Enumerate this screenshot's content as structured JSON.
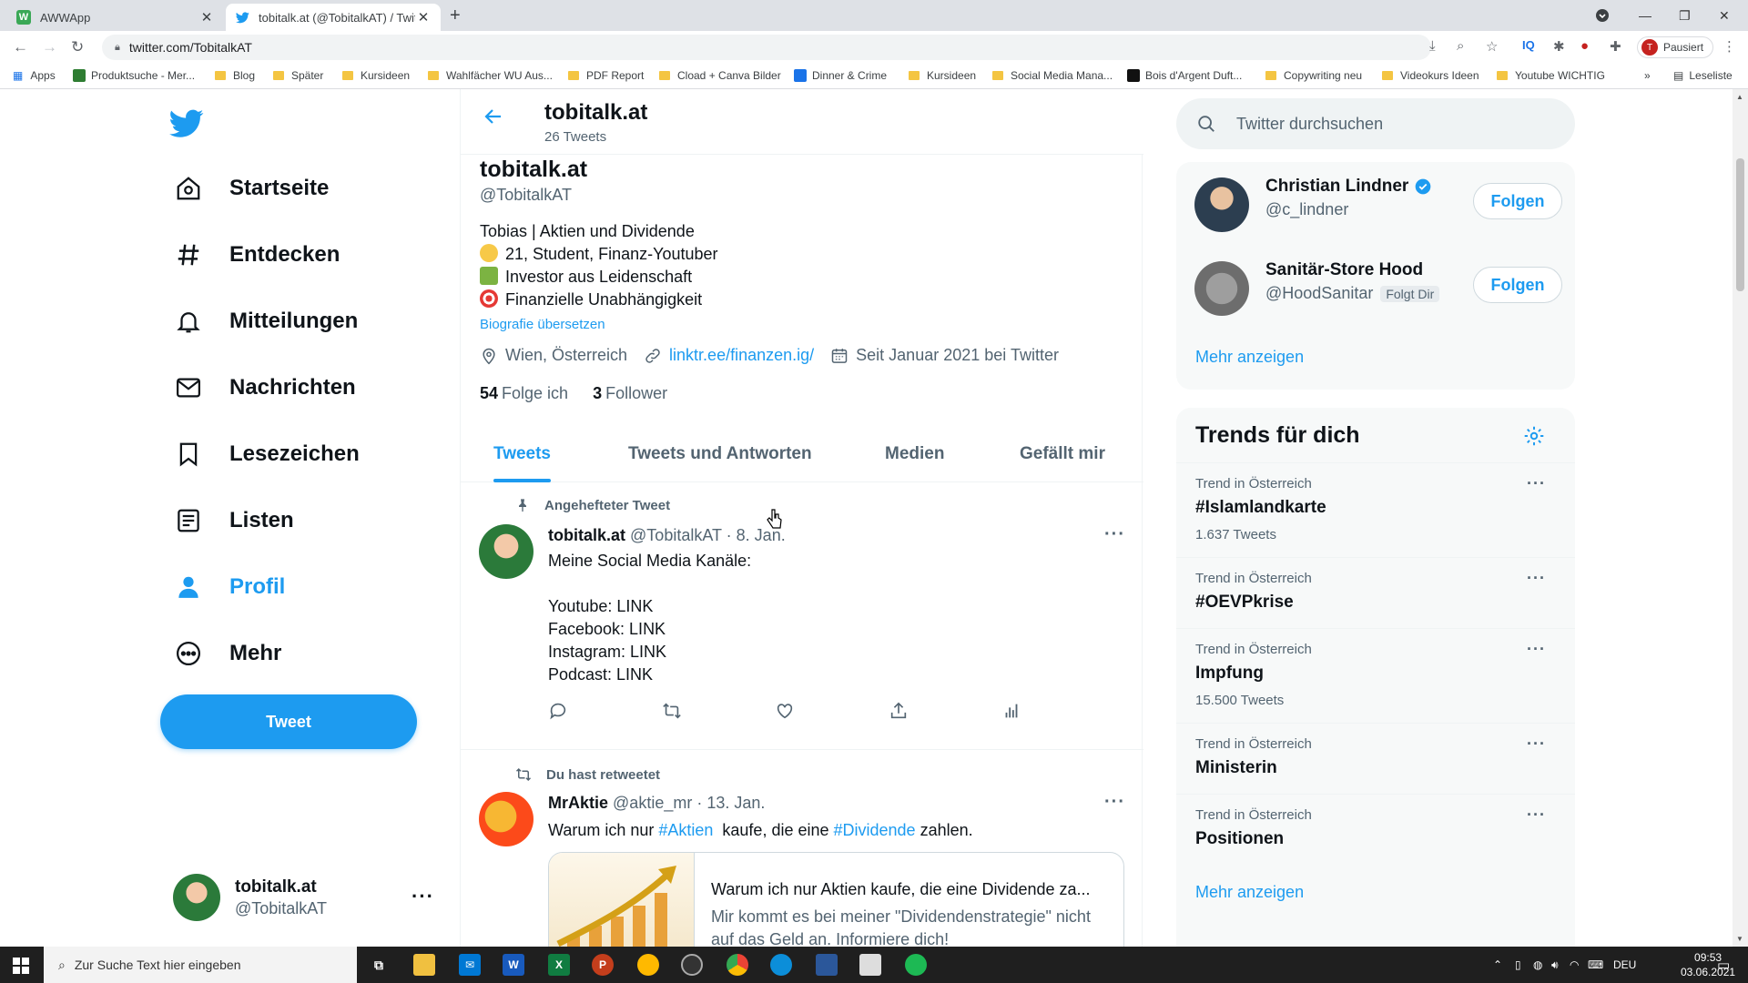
{
  "browser": {
    "tabs": [
      {
        "title": "AWWApp",
        "favicon": "awwapp-icon",
        "active": false
      },
      {
        "title": "tobitalk.at (@TobitalkAT) / Twitte",
        "favicon": "twitter-icon",
        "active": true
      }
    ],
    "address": "twitter.com/TobitalkAT",
    "profile_button": "Pausiert",
    "profile_initial": "T",
    "bookmarks": [
      "Apps",
      "Produktsuche - Mer...",
      "Blog",
      "Später",
      "Kursideen",
      "Wahlfächer WU Aus...",
      "PDF Report",
      "Cload + Canva Bilder",
      "Dinner & Crime",
      "Kursideen",
      "Social Media Mana...",
      "Bois d'Argent Duft...",
      "Copywriting neu",
      "Videokurs Ideen",
      "Youtube WICHTIG"
    ],
    "bookmarks_overflow": "»",
    "reading_list": "Leseliste"
  },
  "nav": {
    "items": [
      {
        "label": "Startseite",
        "icon": "home-icon"
      },
      {
        "label": "Entdecken",
        "icon": "hashtag-icon"
      },
      {
        "label": "Mitteilungen",
        "icon": "bell-icon"
      },
      {
        "label": "Nachrichten",
        "icon": "envelope-icon"
      },
      {
        "label": "Lesezeichen",
        "icon": "bookmark-icon"
      },
      {
        "label": "Listen",
        "icon": "list-icon"
      },
      {
        "label": "Profil",
        "icon": "person-icon"
      },
      {
        "label": "Mehr",
        "icon": "more-circle-icon"
      }
    ],
    "tweet_button": "Tweet",
    "account": {
      "name": "tobitalk.at",
      "handle": "@TobitalkAT",
      "more": "···"
    }
  },
  "header": {
    "title": "tobitalk.at",
    "subtitle": "26 Tweets"
  },
  "profile": {
    "name": "tobitalk.at",
    "handle": "@TobitalkAT",
    "bio": [
      "Tobias | Aktien und Dividende",
      "21, Student, Finanz-Youtuber",
      "Investor aus Leidenschaft",
      "Finanzielle Unabhängigkeit"
    ],
    "translate": "Biografie übersetzen",
    "location": "Wien, Österreich",
    "link": "linktr.ee/finanzen.ig/",
    "joined": "Seit Januar 2021 bei Twitter",
    "following_count": "54",
    "following_label": "Folge ich",
    "followers_count": "3",
    "followers_label": "Follower"
  },
  "profile_tabs": [
    "Tweets",
    "Tweets und Antworten",
    "Medien",
    "Gefällt mir"
  ],
  "tweets": [
    {
      "context": "Angehefteter Tweet",
      "name": "tobitalk.at",
      "meta": "@TobitalkAT · 8. Jan.",
      "body": "Meine Social Media Kanäle:\n\nYoutube: LINK\nFacebook: LINK\nInstagram: LINK\nPodcast: LINK",
      "more": "···"
    },
    {
      "context": "Du hast retweetet",
      "name": "MrAktie",
      "meta": "@aktie_mr · 13. Jan.",
      "body_pre": "Warum ich nur ",
      "tag1": "#Aktien",
      "body_mid": "  kaufe, die eine ",
      "tag2": "#Dividende",
      "body_post": " zahlen.",
      "card_title": "Warum ich nur Aktien kaufe, die eine Dividende za...",
      "card_desc": "Mir kommt es bei meiner \"Dividendenstrategie\" nicht auf das Geld an. Informiere dich!",
      "more": "···"
    }
  ],
  "search": {
    "placeholder": "Twitter durchsuchen"
  },
  "who_to_follow": [
    {
      "name": "Christian Lindner",
      "handle": "@c_lindner",
      "verified": true,
      "follows_you": "",
      "button": "Folgen"
    },
    {
      "name": "Sanitär-Store Hood",
      "handle": "@HoodSanitar",
      "verified": false,
      "follows_you": "Folgt Dir",
      "button": "Folgen"
    }
  ],
  "who_more": "Mehr anzeigen",
  "trends": {
    "title": "Trends für dich",
    "items": [
      {
        "context": "Trend in Österreich",
        "name": "#Islamlandkarte",
        "count": "1.637 Tweets"
      },
      {
        "context": "Trend in Österreich",
        "name": "#OEVPkrise",
        "count": ""
      },
      {
        "context": "Trend in Österreich",
        "name": "Impfung",
        "count": "15.500 Tweets"
      },
      {
        "context": "Trend in Österreich",
        "name": "Ministerin",
        "count": ""
      },
      {
        "context": "Trend in Österreich",
        "name": "Positionen",
        "count": ""
      }
    ],
    "more": "Mehr anzeigen",
    "item_more": "···"
  },
  "taskbar": {
    "search_placeholder": "Zur Suche Text hier eingeben",
    "language": "DEU",
    "time": "09:53",
    "date": "03.06.2021"
  },
  "colors": {
    "accent": "#1d9bf0",
    "text": "#0f1419",
    "muted": "#536471"
  }
}
